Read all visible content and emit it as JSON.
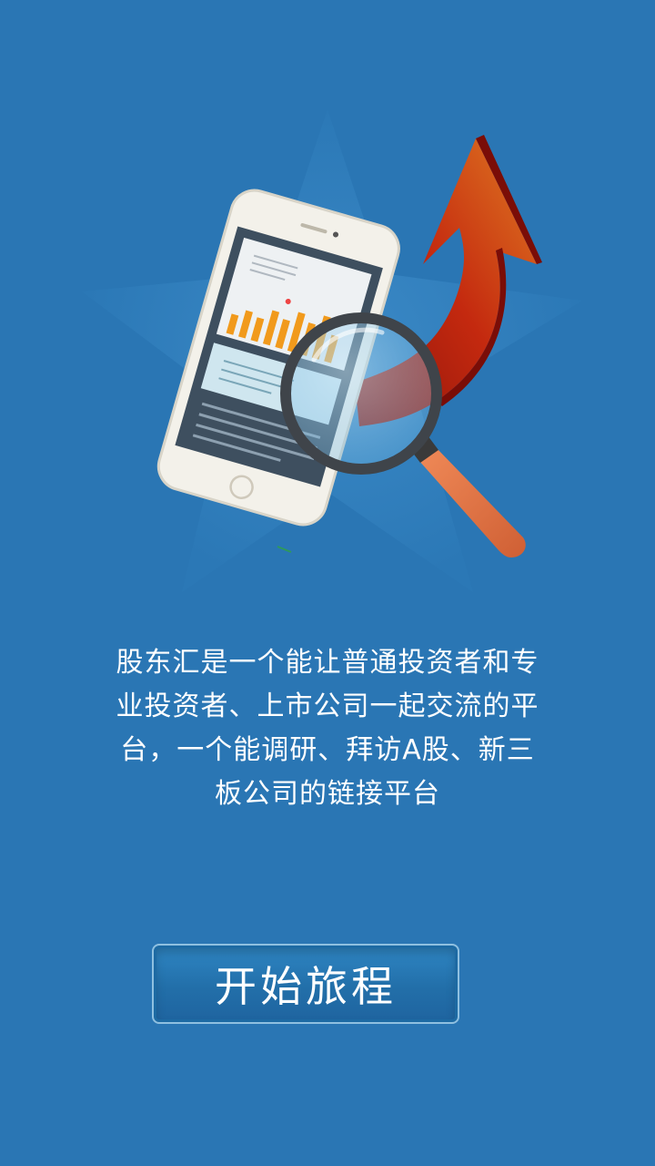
{
  "intro": {
    "description_lines": [
      "股东汇是一个能让普通投资者和专",
      "业投资者、上市公司一起交流的平",
      "台，一个能调研、拜访A股、新三",
      "板公司的链接平台"
    ]
  },
  "actions": {
    "start_label": "开始旅程"
  },
  "colors": {
    "background": "#2a76b4",
    "arrow": "#b81a0a",
    "magnifier_handle": "#e2784a",
    "chart_bars": "#f19a1c"
  },
  "icons": {
    "hero": "phone-chart-magnifier-arrow-illustration"
  }
}
